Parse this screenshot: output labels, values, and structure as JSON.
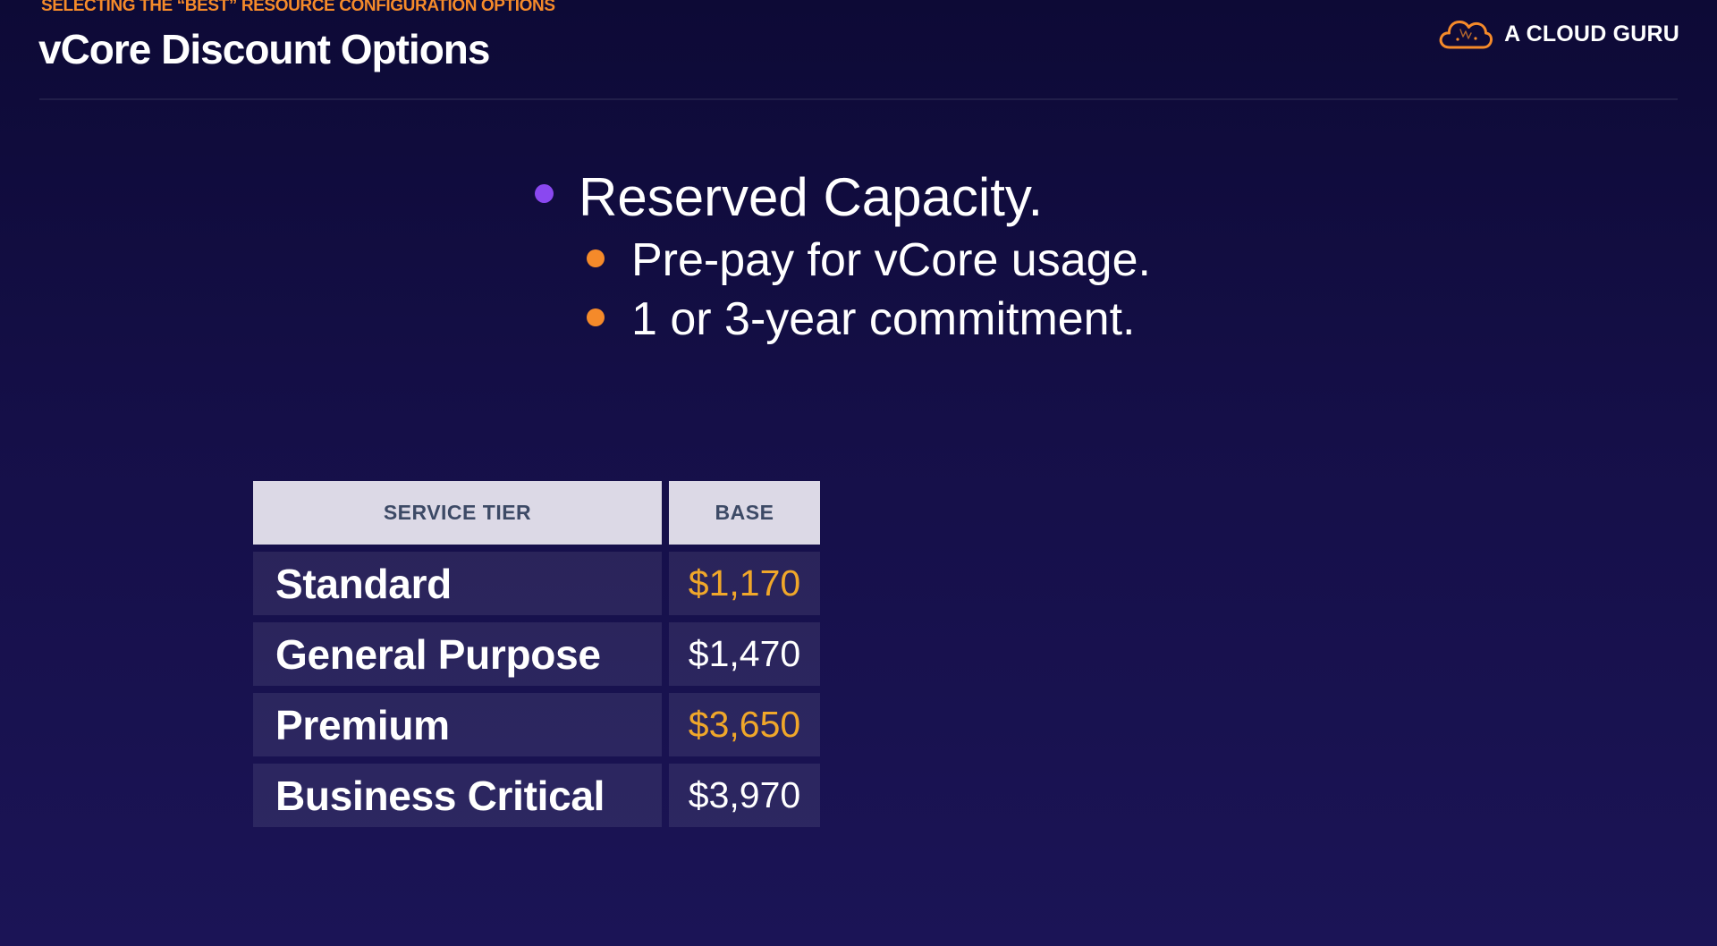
{
  "header": {
    "kicker": "SELECTING THE “BEST” RESOURCE CONFIGURATION OPTIONS",
    "title": "vCore Discount Options",
    "brand_name": "A CLOUD GURU",
    "brand_icon": "cloud-logo-icon"
  },
  "bullets": {
    "main": "Reserved Capacity.",
    "subs": [
      "Pre-pay for vCore usage.",
      "1 or 3-year commitment."
    ]
  },
  "table": {
    "headers": [
      "SERVICE TIER",
      "BASE"
    ],
    "rows": [
      {
        "tier": "Standard",
        "base": "$1,170"
      },
      {
        "tier": "General Purpose",
        "base": "$1,470"
      },
      {
        "tier": "Premium",
        "base": "$3,650"
      },
      {
        "tier": "Business Critical",
        "base": "$3,970"
      }
    ]
  },
  "colors": {
    "background": "#150f48",
    "accent_orange": "#f58a2a",
    "accent_purple": "#8a48f0",
    "price_highlight": "#f0a72a",
    "header_cell": "#dcd9e6",
    "header_text": "#3d4a66"
  }
}
